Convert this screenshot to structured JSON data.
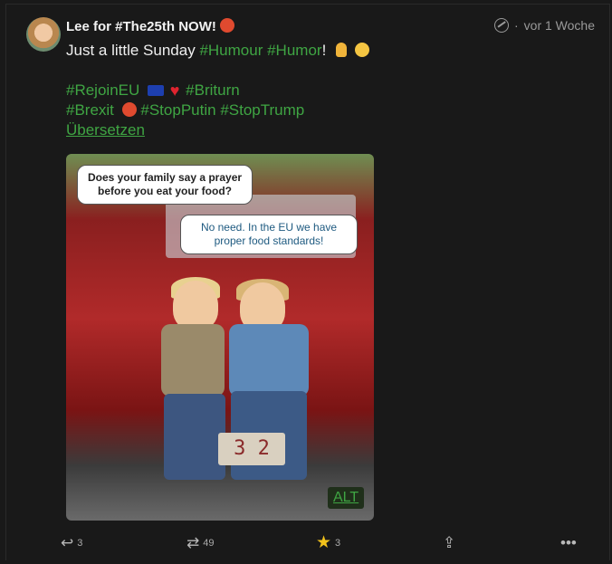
{
  "post": {
    "author": "Lee for #The25th NOW!",
    "visibility_icon": "globe-icon",
    "separator": "·",
    "time": "vor 1 Woche",
    "line1_text": "Just a little Sunday",
    "line1_tag1": "#Humour",
    "line1_tag2": "#Humor",
    "line1_end": "!",
    "tags_line2": [
      "#RejoinEU",
      "#Briturn"
    ],
    "tags_line3": [
      "#Brexit",
      "#StopPutin",
      "#StopTrump"
    ],
    "translate_label": "Übersetzen"
  },
  "media": {
    "bubble1": "Does your family say a prayer before you eat your food?",
    "bubble2": "No need. In the EU we have proper food standards!",
    "plate": "3 2",
    "alt_label": "ALT"
  },
  "actions": {
    "reply_count": "3",
    "boost_count": "49",
    "fav_count": "3",
    "reply_icon": "reply-icon",
    "boost_icon": "boost-icon",
    "star_icon": "star-icon",
    "share_icon": "share-icon",
    "more_icon": "more-icon",
    "star_color": "#f2c21b",
    "tag_color": "#3fa543"
  }
}
